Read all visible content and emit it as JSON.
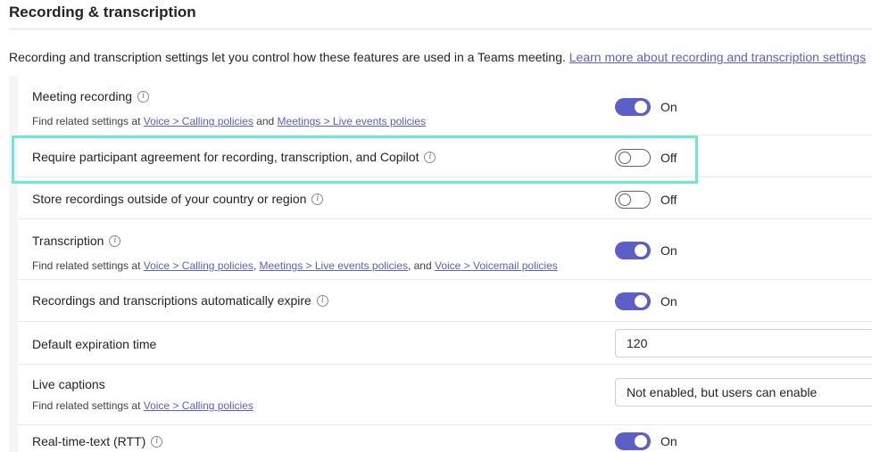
{
  "header": {
    "title": "Recording & transcription"
  },
  "intro": {
    "text": "Recording and transcription settings let you control how these features are used in a Teams meeting.",
    "link": "Learn more about recording and transcription settings"
  },
  "settings": {
    "meeting_recording": {
      "label": "Meeting recording",
      "help_prefix": "Find related settings at",
      "link1": "Voice > Calling policies",
      "and": "and",
      "link2": "Meetings > Live events policies",
      "state": "On"
    },
    "participant_agreement": {
      "label": "Require participant agreement for recording, transcription, and Copilot",
      "state": "Off"
    },
    "store_outside": {
      "label": "Store recordings outside of your country or region",
      "state": "Off"
    },
    "transcription": {
      "label": "Transcription",
      "help_prefix": "Find related settings at",
      "link1": "Voice > Calling policies",
      "sep": ",",
      "link2": "Meetings > Live events policies",
      "and": ", and",
      "link3": "Voice > Voicemail policies",
      "state": "On"
    },
    "auto_expire": {
      "label": "Recordings and transcriptions automatically expire",
      "state": "On"
    },
    "default_expiration": {
      "label": "Default expiration time",
      "value": "120"
    },
    "live_captions": {
      "label": "Live captions",
      "help_prefix": "Find related settings at",
      "link1": "Voice > Calling policies",
      "value": "Not enabled, but users can enable"
    },
    "rtt": {
      "label": "Real-time-text (RTT)",
      "state": "On"
    }
  },
  "colors": {
    "accent": "#5b5fc7",
    "highlight": "#6ee7d9"
  },
  "icons": {
    "info": "info-icon"
  }
}
